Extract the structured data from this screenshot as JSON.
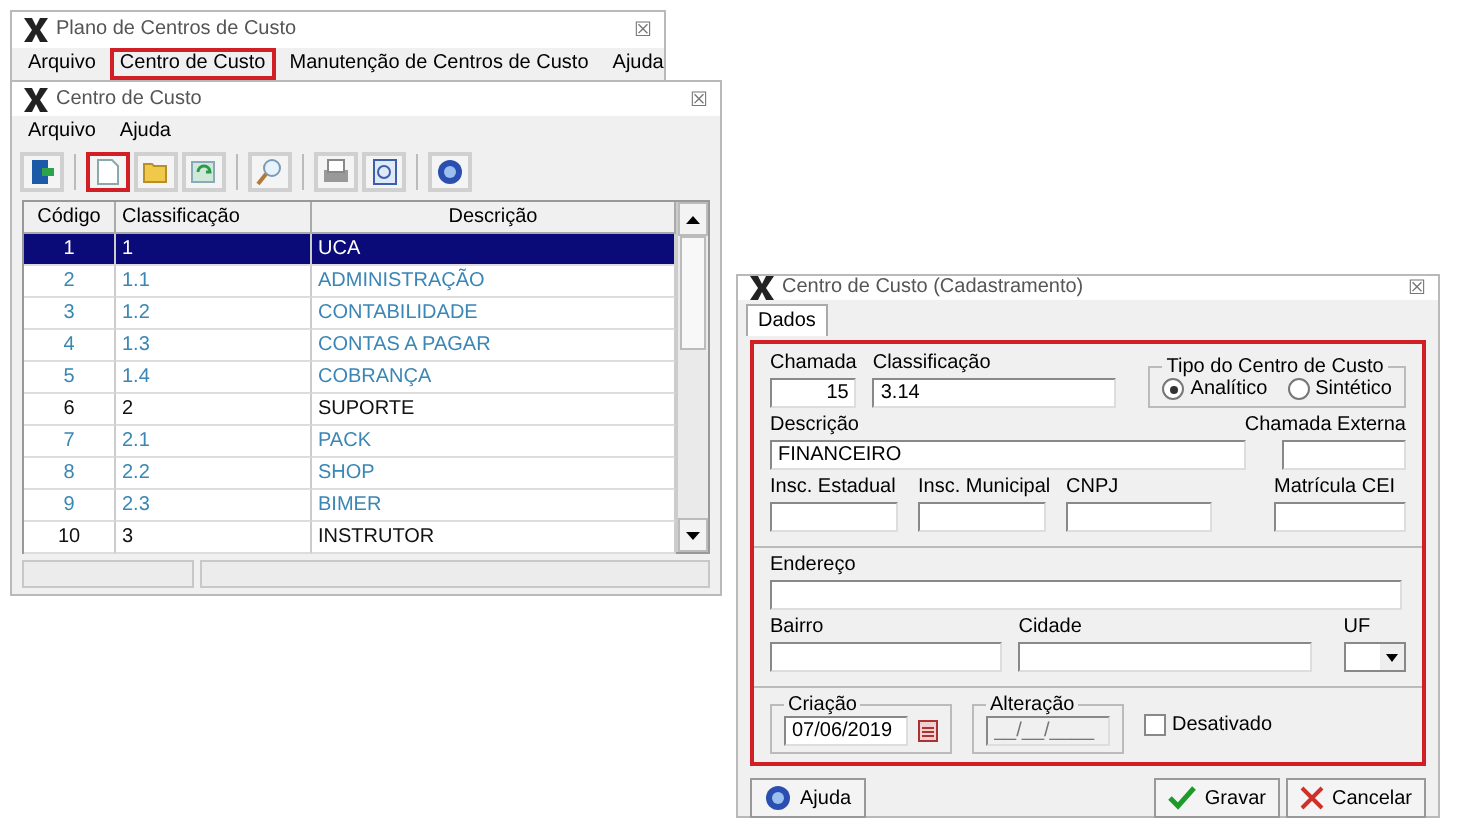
{
  "back_window": {
    "title": "Plano de Centros de Custo",
    "close": "☒",
    "menu": [
      {
        "label": "Arquivo",
        "highlighted": false
      },
      {
        "label": "Centro de Custo",
        "highlighted": true
      },
      {
        "label": "Manutenção de Centros de Custo",
        "highlighted": false
      },
      {
        "label": "Ajuda",
        "highlighted": false
      }
    ]
  },
  "list_window": {
    "title": "Centro de Custo",
    "close": "☒",
    "menu": [
      {
        "label": "Arquivo"
      },
      {
        "label": "Ajuda"
      }
    ],
    "toolbar": [
      {
        "kind": "exit",
        "highlighted": false
      },
      {
        "kind": "new",
        "highlighted": true
      },
      {
        "kind": "open",
        "highlighted": false
      },
      {
        "kind": "refresh",
        "highlighted": false
      },
      {
        "kind": "search",
        "highlighted": false
      },
      {
        "kind": "print",
        "highlighted": false
      },
      {
        "kind": "preview",
        "highlighted": false
      },
      {
        "kind": "help",
        "highlighted": false
      }
    ],
    "table": {
      "columns": [
        "Código",
        "Classificação",
        "Descrição"
      ],
      "rows": [
        {
          "cells": [
            "1",
            "1",
            "UCA"
          ],
          "kind": "parent",
          "selected": true
        },
        {
          "cells": [
            "2",
            "1.1",
            "ADMINISTRAÇÃO"
          ],
          "kind": "child",
          "selected": false
        },
        {
          "cells": [
            "3",
            "1.2",
            "CONTABILIDADE"
          ],
          "kind": "child",
          "selected": false
        },
        {
          "cells": [
            "4",
            "1.3",
            "CONTAS A PAGAR"
          ],
          "kind": "child",
          "selected": false
        },
        {
          "cells": [
            "5",
            "1.4",
            "COBRANÇA"
          ],
          "kind": "child",
          "selected": false
        },
        {
          "cells": [
            "6",
            "2",
            "SUPORTE"
          ],
          "kind": "parent",
          "selected": false
        },
        {
          "cells": [
            "7",
            "2.1",
            "PACK"
          ],
          "kind": "child",
          "selected": false
        },
        {
          "cells": [
            "8",
            "2.2",
            "SHOP"
          ],
          "kind": "child",
          "selected": false
        },
        {
          "cells": [
            "9",
            "2.3",
            "BIMER"
          ],
          "kind": "child",
          "selected": false
        },
        {
          "cells": [
            "10",
            "3",
            "INSTRUTOR"
          ],
          "kind": "parent",
          "selected": false
        }
      ]
    }
  },
  "dialog": {
    "title": "Centro de Custo (Cadastramento)",
    "close": "☒",
    "tabs": [
      {
        "label": "Dados",
        "selected": true
      }
    ],
    "highlighted": true,
    "chamada": {
      "label": "Chamada",
      "value": "15"
    },
    "classificacao": {
      "label": "Classificação",
      "value": "3.14"
    },
    "tipo": {
      "label": "Tipo do Centro de Custo",
      "options": [
        {
          "label": "Analítico",
          "selected": true
        },
        {
          "label": "Sintético",
          "selected": false
        }
      ]
    },
    "descricao": {
      "label": "Descrição",
      "value": "FINANCEIRO"
    },
    "chamada_externa": {
      "label": "Chamada Externa"
    },
    "inscricoes": [
      {
        "label": "Insc. Estadual"
      },
      {
        "label": "Insc. Municipal"
      },
      {
        "label": "CNPJ"
      },
      {
        "label": "Matrícula CEI"
      }
    ],
    "endereco": {
      "label": "Endereço"
    },
    "bairro": {
      "label": "Bairro"
    },
    "cidade": {
      "label": "Cidade"
    },
    "uf": {
      "label": "UF"
    },
    "criacao": {
      "label": "Criação",
      "value": "07/06/2019"
    },
    "alteracao": {
      "label": "Alteração",
      "placeholder": "__/__/____"
    },
    "desativado": {
      "label": "Desativado",
      "checked": false
    },
    "buttons": [
      {
        "label": "Ajuda",
        "kind": "help"
      },
      {
        "label": "Gravar",
        "kind": "save"
      },
      {
        "label": "Cancelar",
        "kind": "cancel"
      }
    ]
  }
}
